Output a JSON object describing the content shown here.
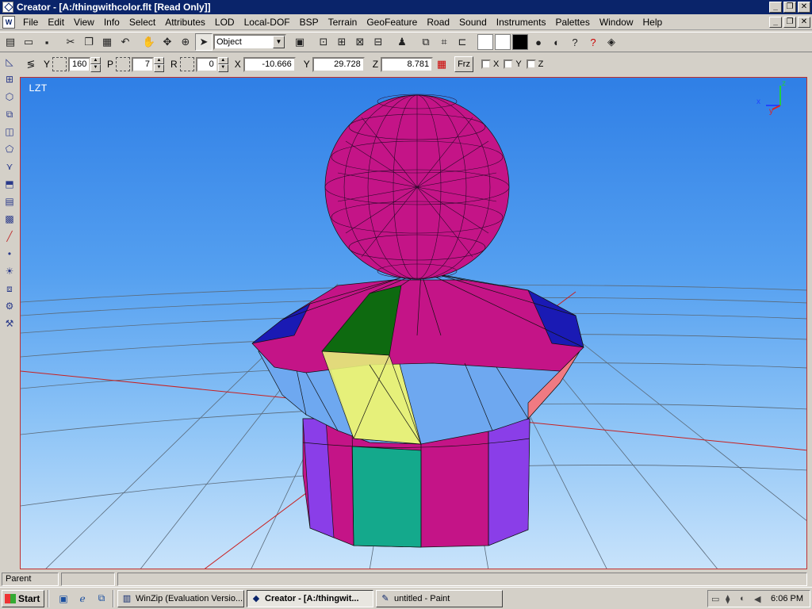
{
  "window": {
    "title": "Creator - [A:/thingwithcolor.flt [Read Only]]",
    "buttons": [
      "_",
      "❐",
      "✕"
    ]
  },
  "menu": {
    "items": [
      "File",
      "Edit",
      "View",
      "Info",
      "Select",
      "Attributes",
      "LOD",
      "Local-DOF",
      "BSP",
      "Terrain",
      "GeoFeature",
      "Road",
      "Sound",
      "Instruments",
      "Palettes",
      "Window",
      "Help"
    ]
  },
  "toolbar": {
    "mode_select": "Object",
    "icons": [
      "new-icon",
      "open-icon",
      "save-icon",
      "cut-icon",
      "copy-icon",
      "paste-icon",
      "undo-icon",
      "pan-icon",
      "move-icon",
      "zoom-icon",
      "pointer-icon"
    ],
    "colors": {
      "white1": "#ffffff",
      "white2": "#ffffff",
      "black": "#000000"
    }
  },
  "coords": {
    "y_label": "Y",
    "y_value": "160",
    "p_label": "P",
    "p_value": "7",
    "r_label": "R",
    "r_value": "0",
    "x_label": "X",
    "x_value": "-10.666",
    "y2_label": "Y",
    "y2_value": "29.728",
    "z_label": "Z",
    "z_value": "8.781",
    "frz_label": "Frz",
    "chk_x": "X",
    "chk_y": "Y",
    "chk_z": "Z"
  },
  "viewport": {
    "label": "LZT",
    "colors": {
      "magenta": "#c41487",
      "blue": "#1a1ab4",
      "green": "#0e6a10",
      "yellow": "#e6f07a",
      "lightblue": "#6ea8f0",
      "teal": "#14a98c",
      "purple": "#8a3ee8",
      "salmon": "#f07a82"
    }
  },
  "status": {
    "parent_label": "Parent",
    "field2": "",
    "field3": ""
  },
  "taskbar": {
    "start_label": "Start",
    "tasks": [
      {
        "label": "WinZip (Evaluation Versio..."
      },
      {
        "label": "Creator - [A:/thingwit..."
      },
      {
        "label": "untitled - Paint"
      }
    ],
    "clock": "6:06 PM"
  }
}
